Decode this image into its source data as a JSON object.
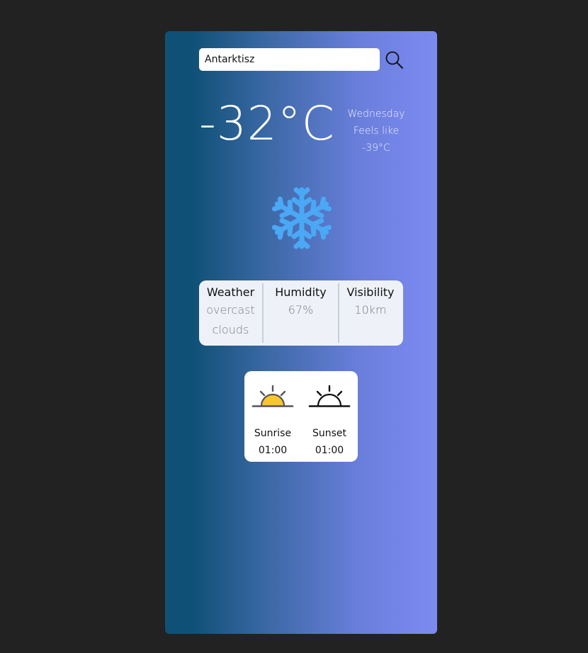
{
  "search": {
    "value": "Antarktisz"
  },
  "current": {
    "temperature": "-32°C",
    "day": "Wednesday",
    "feels_like_label": "Feels like",
    "feels_like_value": "-39°C",
    "icon": "snowflake-icon"
  },
  "stats": [
    {
      "label": "Weather",
      "value": "overcast clouds"
    },
    {
      "label": "Humidity",
      "value": "67%"
    },
    {
      "label": "Visibility",
      "value": "10km"
    }
  ],
  "sun": {
    "sunrise_label": "Sunrise",
    "sunrise_time": "01:00",
    "sunset_label": "Sunset",
    "sunset_time": "01:00"
  },
  "colors": {
    "background": "#222222",
    "gradient_start": "#0f5176",
    "gradient_end": "#7d8af1",
    "snowflake": "#4aa8f5",
    "sunrise_sun": "#f8c630",
    "panel": "#eef2f8"
  }
}
